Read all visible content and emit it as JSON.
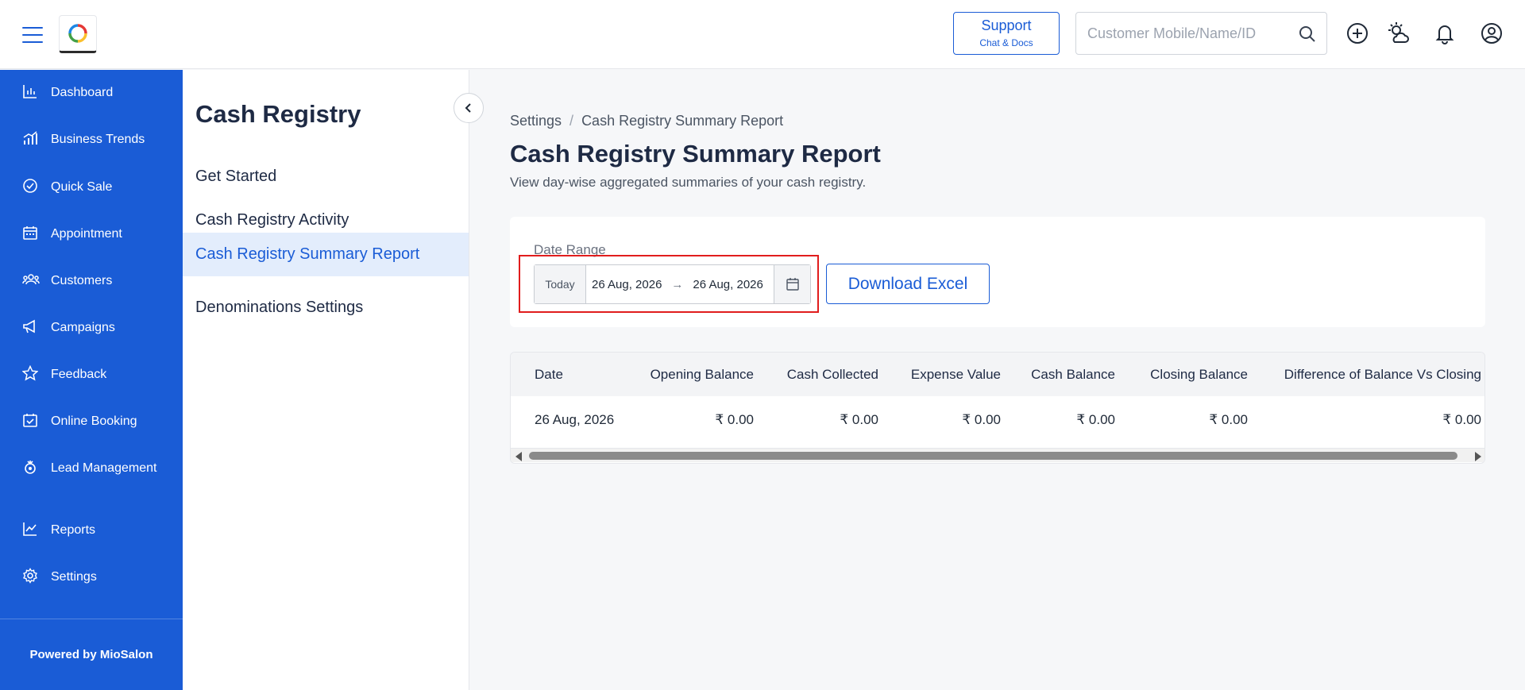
{
  "topbar": {
    "support_label": "Support",
    "support_sub": "Chat & Docs",
    "search_placeholder": "Customer Mobile/Name/ID",
    "icons": [
      "menu-icon",
      "logo",
      "search-icon",
      "plus-circle-icon",
      "sun-cloud-icon",
      "bell-icon",
      "user-circle-icon"
    ]
  },
  "sidebar": {
    "items": [
      {
        "label": "Dashboard",
        "icon": "bar-chart-icon"
      },
      {
        "label": "Business Trends",
        "icon": "trend-chart-icon"
      },
      {
        "label": "Quick Sale",
        "icon": "check-circle-icon"
      },
      {
        "label": "Appointment",
        "icon": "calendar-icon"
      },
      {
        "label": "Customers",
        "icon": "users-icon"
      },
      {
        "label": "Campaigns",
        "icon": "megaphone-icon"
      },
      {
        "label": "Feedback",
        "icon": "star-icon"
      },
      {
        "label": "Online Booking",
        "icon": "calendar-check-icon"
      },
      {
        "label": "Lead Management",
        "icon": "lead-icon"
      },
      {
        "label": "Reports",
        "icon": "line-chart-icon"
      },
      {
        "label": "Settings",
        "icon": "gear-icon"
      }
    ],
    "footer": "Powered by MioSalon",
    "color": "#1a5cd6"
  },
  "subpanel": {
    "title": "Cash Registry",
    "items": [
      {
        "label": "Get Started",
        "active": false
      },
      {
        "label": "Cash Registry Activity",
        "active": false
      },
      {
        "label": "Cash Registry Summary Report",
        "active": true
      },
      {
        "label": "Denominations Settings",
        "active": false
      }
    ]
  },
  "main": {
    "breadcrumb": [
      "Settings",
      "Cash Registry Summary Report"
    ],
    "title": "Cash Registry Summary Report",
    "subtitle": "View day-wise aggregated summaries of your cash registry.",
    "filter": {
      "date_range_label": "Date Range",
      "today_label": "Today",
      "start_date": "26 Aug, 2026",
      "arrow": "→",
      "end_date": "26 Aug, 2026",
      "download_label": "Download Excel"
    },
    "table": {
      "columns": [
        "Date",
        "Opening Balance",
        "Cash Collected",
        "Expense Value",
        "Cash Balance",
        "Closing Balance",
        "Difference of Balance Vs Closing"
      ],
      "rows": [
        [
          "26 Aug, 2026",
          "₹ 0.00",
          "₹ 0.00",
          "₹ 0.00",
          "₹ 0.00",
          "₹ 0.00",
          "₹ 0.00"
        ]
      ]
    }
  }
}
